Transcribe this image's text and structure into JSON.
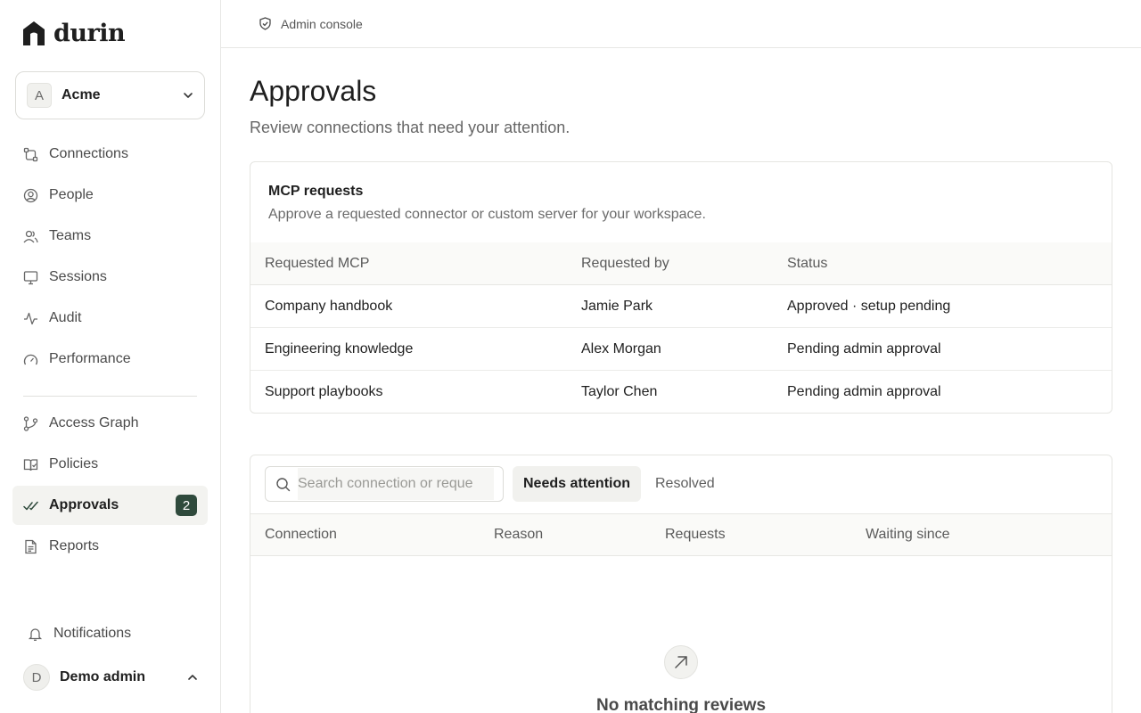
{
  "brand": {
    "name": "durin"
  },
  "org": {
    "initial": "A",
    "name": "Acme"
  },
  "nav": {
    "primary": [
      {
        "label": "Connections",
        "icon": "connections-icon"
      },
      {
        "label": "People",
        "icon": "people-icon"
      },
      {
        "label": "Teams",
        "icon": "teams-icon"
      },
      {
        "label": "Sessions",
        "icon": "sessions-icon"
      },
      {
        "label": "Audit",
        "icon": "audit-icon"
      },
      {
        "label": "Performance",
        "icon": "performance-icon"
      }
    ],
    "secondary": [
      {
        "label": "Access Graph",
        "icon": "access-graph-icon"
      },
      {
        "label": "Policies",
        "icon": "policies-icon"
      },
      {
        "label": "Approvals",
        "icon": "approvals-icon",
        "badge": "2",
        "active": true
      },
      {
        "label": "Reports",
        "icon": "reports-icon"
      }
    ],
    "notifications": "Notifications"
  },
  "user": {
    "initial": "D",
    "name": "Demo admin"
  },
  "topbar": {
    "label": "Admin console"
  },
  "page": {
    "title": "Approvals",
    "subtitle": "Review connections that need your attention."
  },
  "mcp": {
    "title": "MCP requests",
    "subtitle": "Approve a requested connector or custom server for your workspace.",
    "columns": [
      "Requested MCP",
      "Requested by",
      "Status"
    ],
    "rows": [
      {
        "mcp": "Company handbook",
        "by": "Jamie Park",
        "status": "Approved · setup pending"
      },
      {
        "mcp": "Engineering knowledge",
        "by": "Alex Morgan",
        "status": "Pending admin approval"
      },
      {
        "mcp": "Support playbooks",
        "by": "Taylor Chen",
        "status": "Pending admin approval"
      }
    ]
  },
  "reviews": {
    "search_placeholder": "Search connection or reque",
    "tabs": [
      "Needs attention",
      "Resolved"
    ],
    "columns": [
      "Connection",
      "Reason",
      "Requests",
      "Waiting since"
    ],
    "empty": "No matching reviews"
  },
  "colors": {
    "accent": "#2f4a3c",
    "active_bg": "#f3f3f0"
  }
}
